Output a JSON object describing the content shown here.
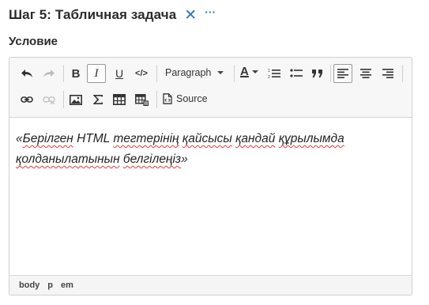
{
  "header": {
    "title": "Шаг 5: Табличная задача",
    "close_icon": "close-icon",
    "more_icon": "more-options-icon",
    "more_glyph": "···",
    "close_glyph": "✕"
  },
  "section": {
    "label": "Условие"
  },
  "toolbar": {
    "paragraph_label": "Paragraph",
    "source_label": "Source",
    "font_color_glyph": "A",
    "bold_glyph": "B",
    "italic_glyph": "I",
    "underline_glyph": "U",
    "code_glyph": "</>"
  },
  "content": {
    "open_quote": "«",
    "word1": "Берілген",
    "word2": "HTML",
    "word3": "тегтерінің",
    "word4": "қайсысы",
    "word5": "қандай",
    "word6": "құрылымда",
    "word7": "қолданылатынын",
    "word8": "белгілеңіз",
    "close_quote": "»"
  },
  "statusbar": {
    "items": [
      "body",
      "p",
      "em"
    ]
  },
  "colors": {
    "accent": "#2f6fd1",
    "spellcheck": "#e53935"
  }
}
